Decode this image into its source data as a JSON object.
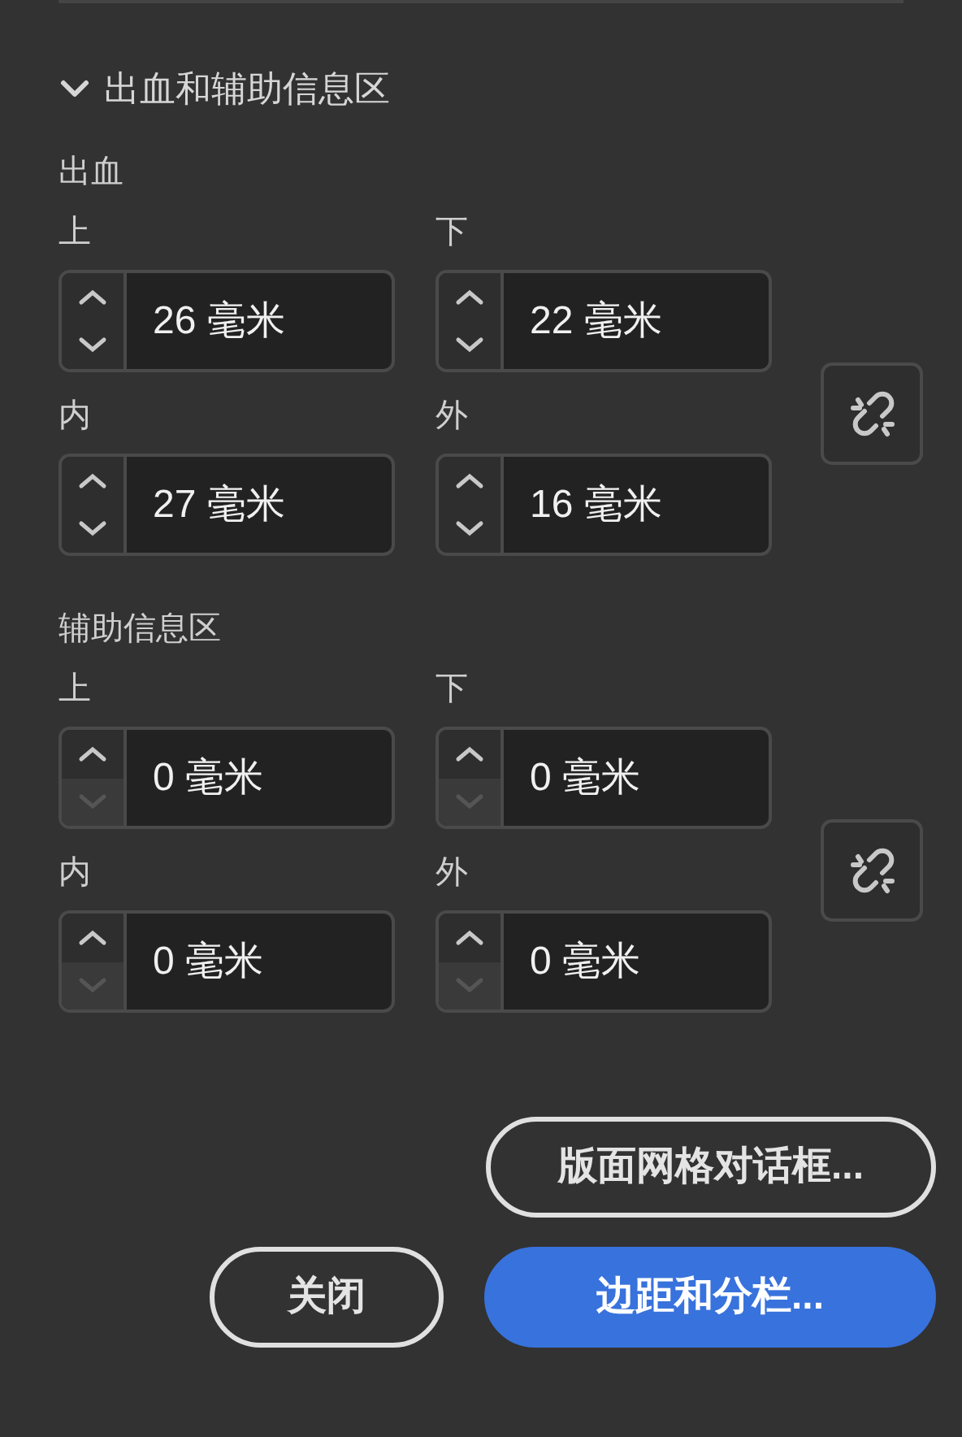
{
  "section": {
    "title": "出血和辅助信息区",
    "expanded": true
  },
  "groups": [
    {
      "title": "出血",
      "linked": false,
      "fields": [
        {
          "label": "上",
          "value": "26 毫米",
          "down_disabled": false
        },
        {
          "label": "下",
          "value": "22 毫米",
          "down_disabled": false
        },
        {
          "label": "内",
          "value": "27 毫米",
          "down_disabled": false
        },
        {
          "label": "外",
          "value": "16 毫米",
          "down_disabled": false
        }
      ]
    },
    {
      "title": "辅助信息区",
      "linked": false,
      "fields": [
        {
          "label": "上",
          "value": "0 毫米",
          "down_disabled": true
        },
        {
          "label": "下",
          "value": "0 毫米",
          "down_disabled": true
        },
        {
          "label": "内",
          "value": "0 毫米",
          "down_disabled": true
        },
        {
          "label": "外",
          "value": "0 毫米",
          "down_disabled": true
        }
      ]
    }
  ],
  "buttons": [
    {
      "label": "版面网格对话框...",
      "kind": "secondary"
    },
    {
      "label": "关闭",
      "kind": "secondary"
    },
    {
      "label": "边距和分栏...",
      "kind": "primary"
    }
  ]
}
